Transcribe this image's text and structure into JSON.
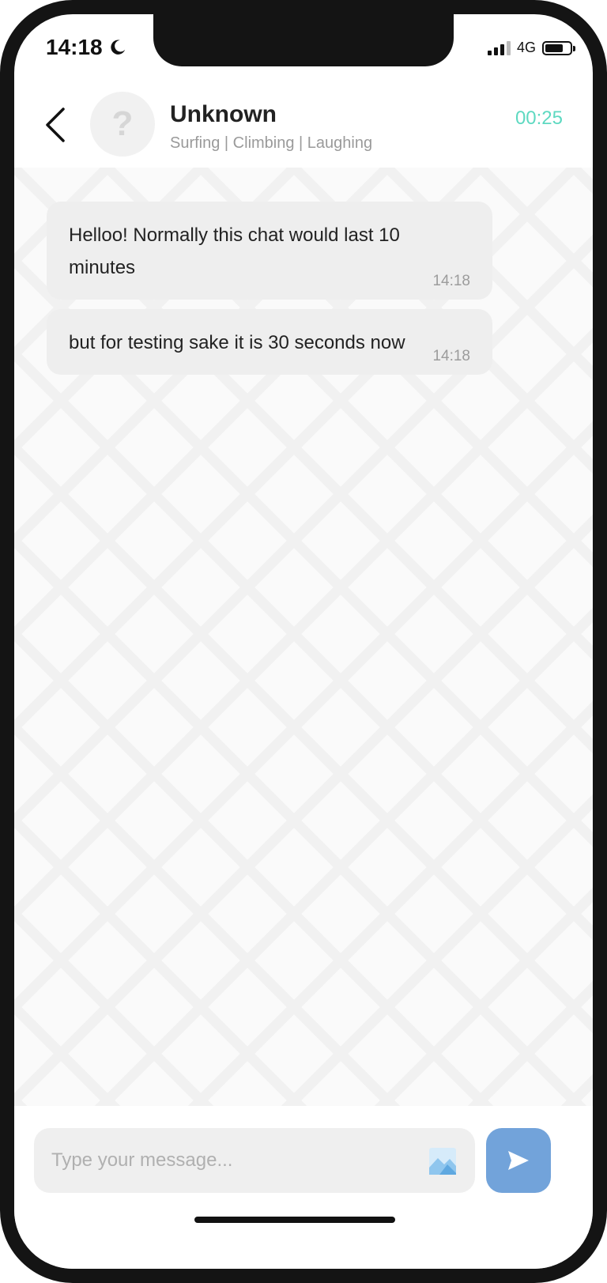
{
  "status_bar": {
    "time": "14:18",
    "network": "4G",
    "icons": [
      "moon-icon",
      "signal-icon",
      "battery-icon"
    ]
  },
  "header": {
    "contact_name": "Unknown",
    "avatar_glyph": "?",
    "tags": "Surfing |  Climbing |  Laughing",
    "timer": "00:25",
    "timer_color": "#5ed9c1"
  },
  "messages": [
    {
      "text": "Helloo! Normally this chat would last 10 minutes",
      "time": "14:18"
    },
    {
      "text": "but for testing sake it is 30 seconds now",
      "time": "14:18"
    }
  ],
  "composer": {
    "placeholder": "Type your message...",
    "send_color": "#72a3da",
    "icons": [
      "image-icon",
      "send-icon"
    ]
  }
}
